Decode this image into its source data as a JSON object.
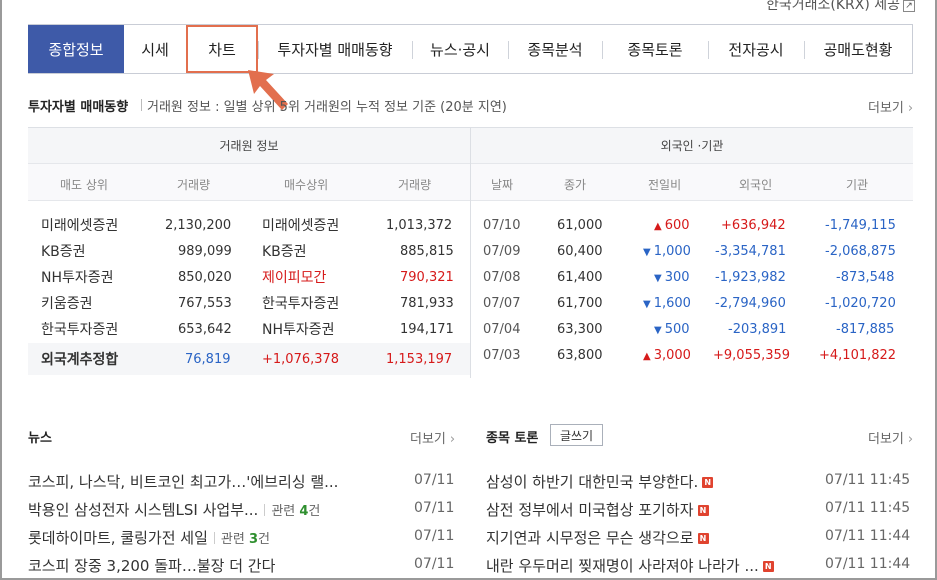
{
  "krx_link": "한국거래소(KRX) 제공",
  "tabs": [
    {
      "label": "종합정보"
    },
    {
      "label": "시세"
    },
    {
      "label": "차트"
    },
    {
      "label": "투자자별 매매동향"
    },
    {
      "label": "뉴스·공시"
    },
    {
      "label": "종목분석"
    },
    {
      "label": "종목토론"
    },
    {
      "label": "전자공시"
    },
    {
      "label": "공매도현황"
    }
  ],
  "investor": {
    "title": "투자자별 매매동향",
    "desc": "거래원 정보 : 일별 상위 5위 거래원의 누적 정보 기준 (20분 지연)",
    "more": "더보기",
    "broker_header": "거래원 정보",
    "foreign_header": "외국인 ·기관",
    "columns_left": [
      "매도 상위",
      "거래량",
      "매수상위",
      "거래량"
    ],
    "columns_right": [
      "날짜",
      "종가",
      "전일비",
      "외국인",
      "기관"
    ],
    "brokers": [
      {
        "sell": "미래에셋증권",
        "sell_vol": "2,130,200",
        "buy": "미래에셋증권",
        "buy_vol": "1,013,372"
      },
      {
        "sell": "KB증권",
        "sell_vol": "989,099",
        "buy": "KB증권",
        "buy_vol": "885,815"
      },
      {
        "sell": "NH투자증권",
        "sell_vol": "850,020",
        "buy": "제이피모간",
        "buy_vol": "790,321"
      },
      {
        "sell": "키움증권",
        "sell_vol": "767,553",
        "buy": "한국투자증권",
        "buy_vol": "781,933"
      },
      {
        "sell": "한국투자증권",
        "sell_vol": "653,642",
        "buy": "NH투자증권",
        "buy_vol": "194,171"
      }
    ],
    "summary": {
      "label": "외국계추정합",
      "sell": "76,819",
      "net": "+1,076,378",
      "buy": "1,153,197"
    },
    "daily": [
      {
        "date": "07/10",
        "close": "61,000",
        "dir": "▲",
        "change": "600",
        "foreign": "+636,942",
        "inst": "-1,749,115"
      },
      {
        "date": "07/09",
        "close": "60,400",
        "dir": "▼",
        "change": "1,000",
        "foreign": "-3,354,781",
        "inst": "-2,068,875"
      },
      {
        "date": "07/08",
        "close": "61,400",
        "dir": "▼",
        "change": "300",
        "foreign": "-1,923,982",
        "inst": "-873,548"
      },
      {
        "date": "07/07",
        "close": "61,700",
        "dir": "▼",
        "change": "1,600",
        "foreign": "-2,794,960",
        "inst": "-1,020,720"
      },
      {
        "date": "07/04",
        "close": "63,300",
        "dir": "▼",
        "change": "500",
        "foreign": "-203,891",
        "inst": "-817,885"
      },
      {
        "date": "07/03",
        "close": "63,800",
        "dir": "▲",
        "change": "3,000",
        "foreign": "+9,055,359",
        "inst": "+4,101,822"
      }
    ]
  },
  "news": {
    "title": "뉴스",
    "more": "더보기",
    "items": [
      {
        "title": "코스피, 나스닥, 비트코인 최고가…'에브리싱 랠...",
        "related": "",
        "count": "",
        "date": "07/11"
      },
      {
        "title": "박용인 삼성전자 시스템LSI 사업부...",
        "related": "관련",
        "count": "4",
        "unit": "건",
        "date": "07/11"
      },
      {
        "title": "롯데하이마트, 쿨링가전 세일",
        "related": "관련",
        "count": "3",
        "unit": "건",
        "date": "07/11"
      },
      {
        "title": "코스피 장중 3,200 돌파…불장 더 간다",
        "related": "",
        "count": "",
        "date": "07/11"
      }
    ]
  },
  "board": {
    "title": "종목 토론",
    "write": "글쓰기",
    "more": "더보기",
    "new_badge": "N",
    "items": [
      {
        "title": "삼성이 하반기 대한민국 부양한다.",
        "date": "07/11 11:45"
      },
      {
        "title": "삼전 정부에서 미국협상 포기하자",
        "date": "07/11 11:45"
      },
      {
        "title": "지기연과 시무정은 무슨 생각으로",
        "date": "07/11 11:44"
      },
      {
        "title": "내란 우두머리 찢재명이 사라져야 나라가 ...",
        "date": "07/11 11:44"
      }
    ]
  },
  "colors": {
    "accent": "#3e5aa8",
    "up": "#d61a1a",
    "down": "#2a64c5",
    "highlight": "#e26f4e"
  }
}
